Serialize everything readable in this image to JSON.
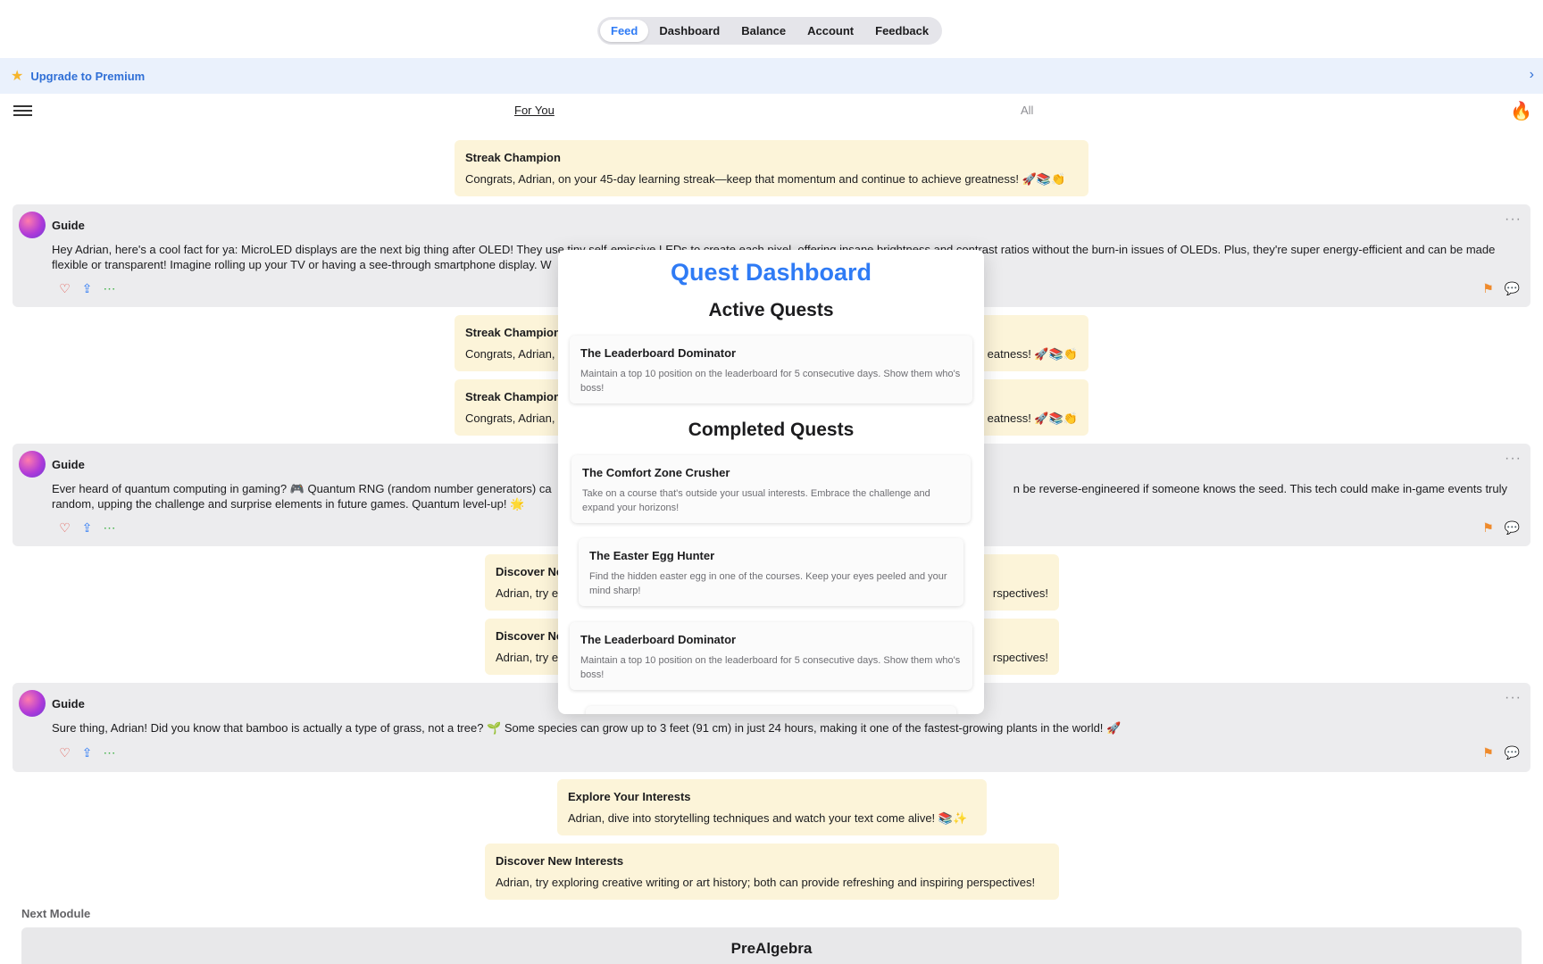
{
  "tabs": {
    "items": [
      {
        "label": "Feed",
        "active": true
      },
      {
        "label": "Dashboard",
        "active": false
      },
      {
        "label": "Balance",
        "active": false
      },
      {
        "label": "Account",
        "active": false
      },
      {
        "label": "Feedback",
        "active": false
      }
    ]
  },
  "premium": {
    "label": "Upgrade to Premium",
    "icon": "star-icon",
    "chevron": "chevron-right-icon"
  },
  "subnav": {
    "for_you": "For You",
    "all": "All"
  },
  "feed": {
    "streak": {
      "title": "Streak Champion",
      "body": "Congrats, Adrian, on your 45-day learning streak—keep that momentum and continue to achieve greatness! 🚀📚👏"
    },
    "streak_partial": {
      "title": "Streak Champion",
      "body_left": "Congrats, Adrian,",
      "body_right": "eatness! 🚀📚👏"
    },
    "guide1": {
      "name": "Guide",
      "text_a": "Hey Adrian, here's a cool fact for ya: MicroLED displays are the next big thing after OLED! They use tiny self-emissive LEDs to create each pixel, offering insane brightness and contrast ratios without the burn-in issues of OLEDs. Plus, they're super energy-efficient and can be made flexible or transparent! Imagine rolling up your TV or having a see-through smartphone display. W"
    },
    "guide2": {
      "name": "Guide",
      "text_a": "Ever heard of quantum computing in gaming? 🎮 Quantum RNG (random number generators) ca",
      "text_b": "n be reverse-engineered if someone knows the seed. This tech could make in-game events truly",
      "text_c": "random, upping the challenge and surprise elements in future games. Quantum level-up! 🌟"
    },
    "discover_partial": {
      "title": "Discover Ne",
      "body_left": "Adrian, try e",
      "body_right": "rspectives!"
    },
    "guide3": {
      "name": "Guide",
      "text_a": "Sure thing, Adrian! Did you know that bamboo is actually a type of grass, not a tree? 🌱 Some species can grow up to 3 feet (91 cm) in just 24 hours, making it one of the fastest-growing plants in the world! 🚀"
    },
    "explore": {
      "title": "Explore Your Interests",
      "body": "Adrian, dive into storytelling techniques and watch your text come alive! 📚✨"
    },
    "discover": {
      "title": "Discover New Interests",
      "body": "Adrian, try exploring creative writing or art history; both can provide refreshing and inspiring perspectives!"
    }
  },
  "next_module": {
    "label": "Next Module",
    "title": "PreAlgebra"
  },
  "modal": {
    "title": "Quest Dashboard",
    "active_heading": "Active Quests",
    "completed_heading": "Completed Quests",
    "active": [
      {
        "title": "The Leaderboard Dominator",
        "desc": "Maintain a top 10 position on the leaderboard for 5 consecutive days. Show them who's boss!"
      }
    ],
    "completed": [
      {
        "title": "The Comfort Zone Crusher",
        "desc": "Take on a course that's outside your usual interests. Embrace the challenge and expand your horizons!"
      },
      {
        "title": "The Easter Egg Hunter",
        "desc": "Find the hidden easter egg in one of the courses. Keep your eyes peeled and your mind sharp!"
      },
      {
        "title": "The Leaderboard Dominator",
        "desc": "Maintain a top 10 position on the leaderboard for 5 consecutive days. Show them who's boss!"
      }
    ]
  },
  "colors": {
    "accent": "#2f7bf5",
    "card_yellow": "#fcf4d9",
    "card_gray": "#ececee",
    "banner": "#eaf1fc"
  }
}
